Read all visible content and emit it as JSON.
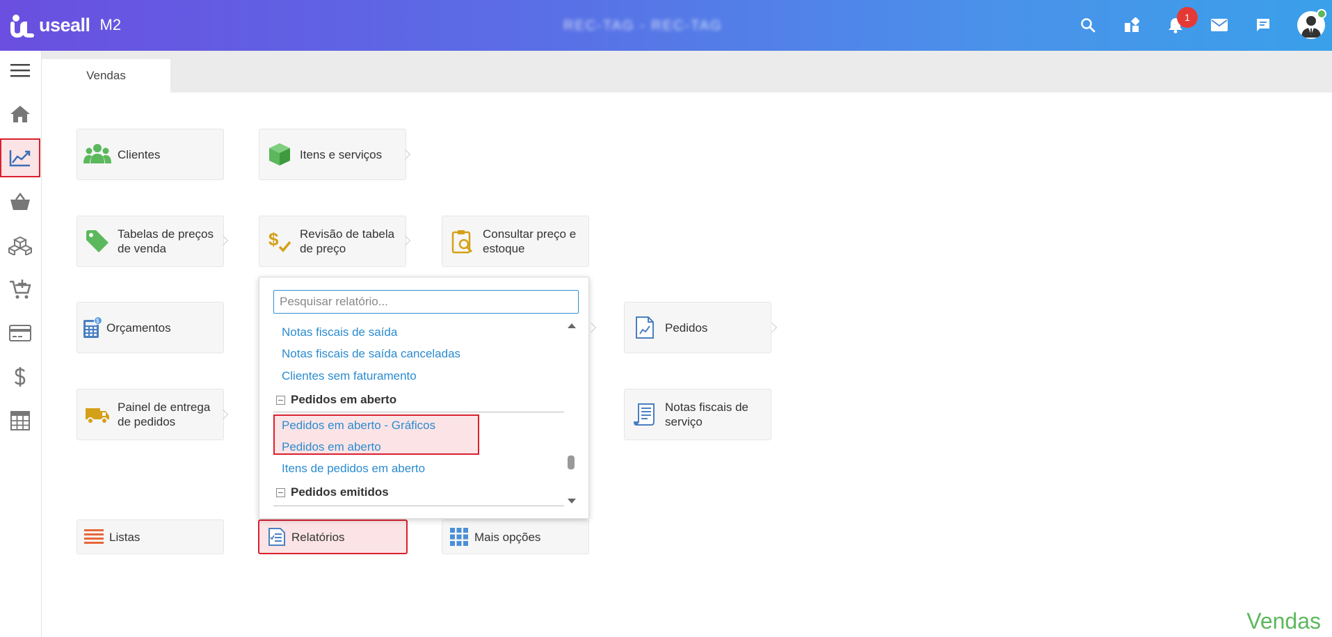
{
  "header": {
    "logo_text": "useall",
    "logo_sub": "M2",
    "blurred_title": "REC-TAG - REC-TAG",
    "notification_count": "1",
    "icons": [
      "search-icon",
      "apps-icon",
      "bell-icon",
      "mail-icon",
      "chat-icon",
      "avatar"
    ]
  },
  "sidebar": {
    "items": [
      "menu-icon",
      "home-icon",
      "chart-line-icon",
      "basket-icon",
      "boxes-icon",
      "cart-add-icon",
      "credit-card-icon",
      "dollar-icon",
      "calculator-icon"
    ],
    "active": "chart-line-icon"
  },
  "tabs": [
    {
      "label": "Vendas"
    }
  ],
  "cards": {
    "clientes": "Clientes",
    "itens": "Itens e serviços",
    "tabelas_l1": "Tabelas de preços",
    "tabelas_l2": "de venda",
    "revisao_l1": "Revisão de tabela",
    "revisao_l2": "de preço",
    "consultar_l1": "Consultar preço e",
    "consultar_l2": "estoque",
    "orcamentos": "Orçamentos",
    "pedidos": "Pedidos",
    "painel_l1": "Painel de entrega",
    "painel_l2": "de pedidos",
    "notas_l1": "Notas fiscais de",
    "notas_l2": "serviço",
    "listas": "Listas",
    "relatorios": "Relatórios",
    "mais": "Mais opções"
  },
  "popup": {
    "search_placeholder": "Pesquisar relatório...",
    "links_top": [
      "Notas fiscais de saída",
      "Notas fiscais de saída canceladas",
      "Clientes sem faturamento"
    ],
    "group1": "Pedidos em aberto",
    "group1_items": [
      "Pedidos em aberto - Gráficos",
      "Pedidos em aberto",
      "Itens de pedidos em aberto"
    ],
    "group2": "Pedidos emitidos"
  },
  "watermark": "Vendas",
  "colors": {
    "accent_red": "#d9202e",
    "link_blue": "#2a8bd0",
    "green": "#5cb85c"
  }
}
